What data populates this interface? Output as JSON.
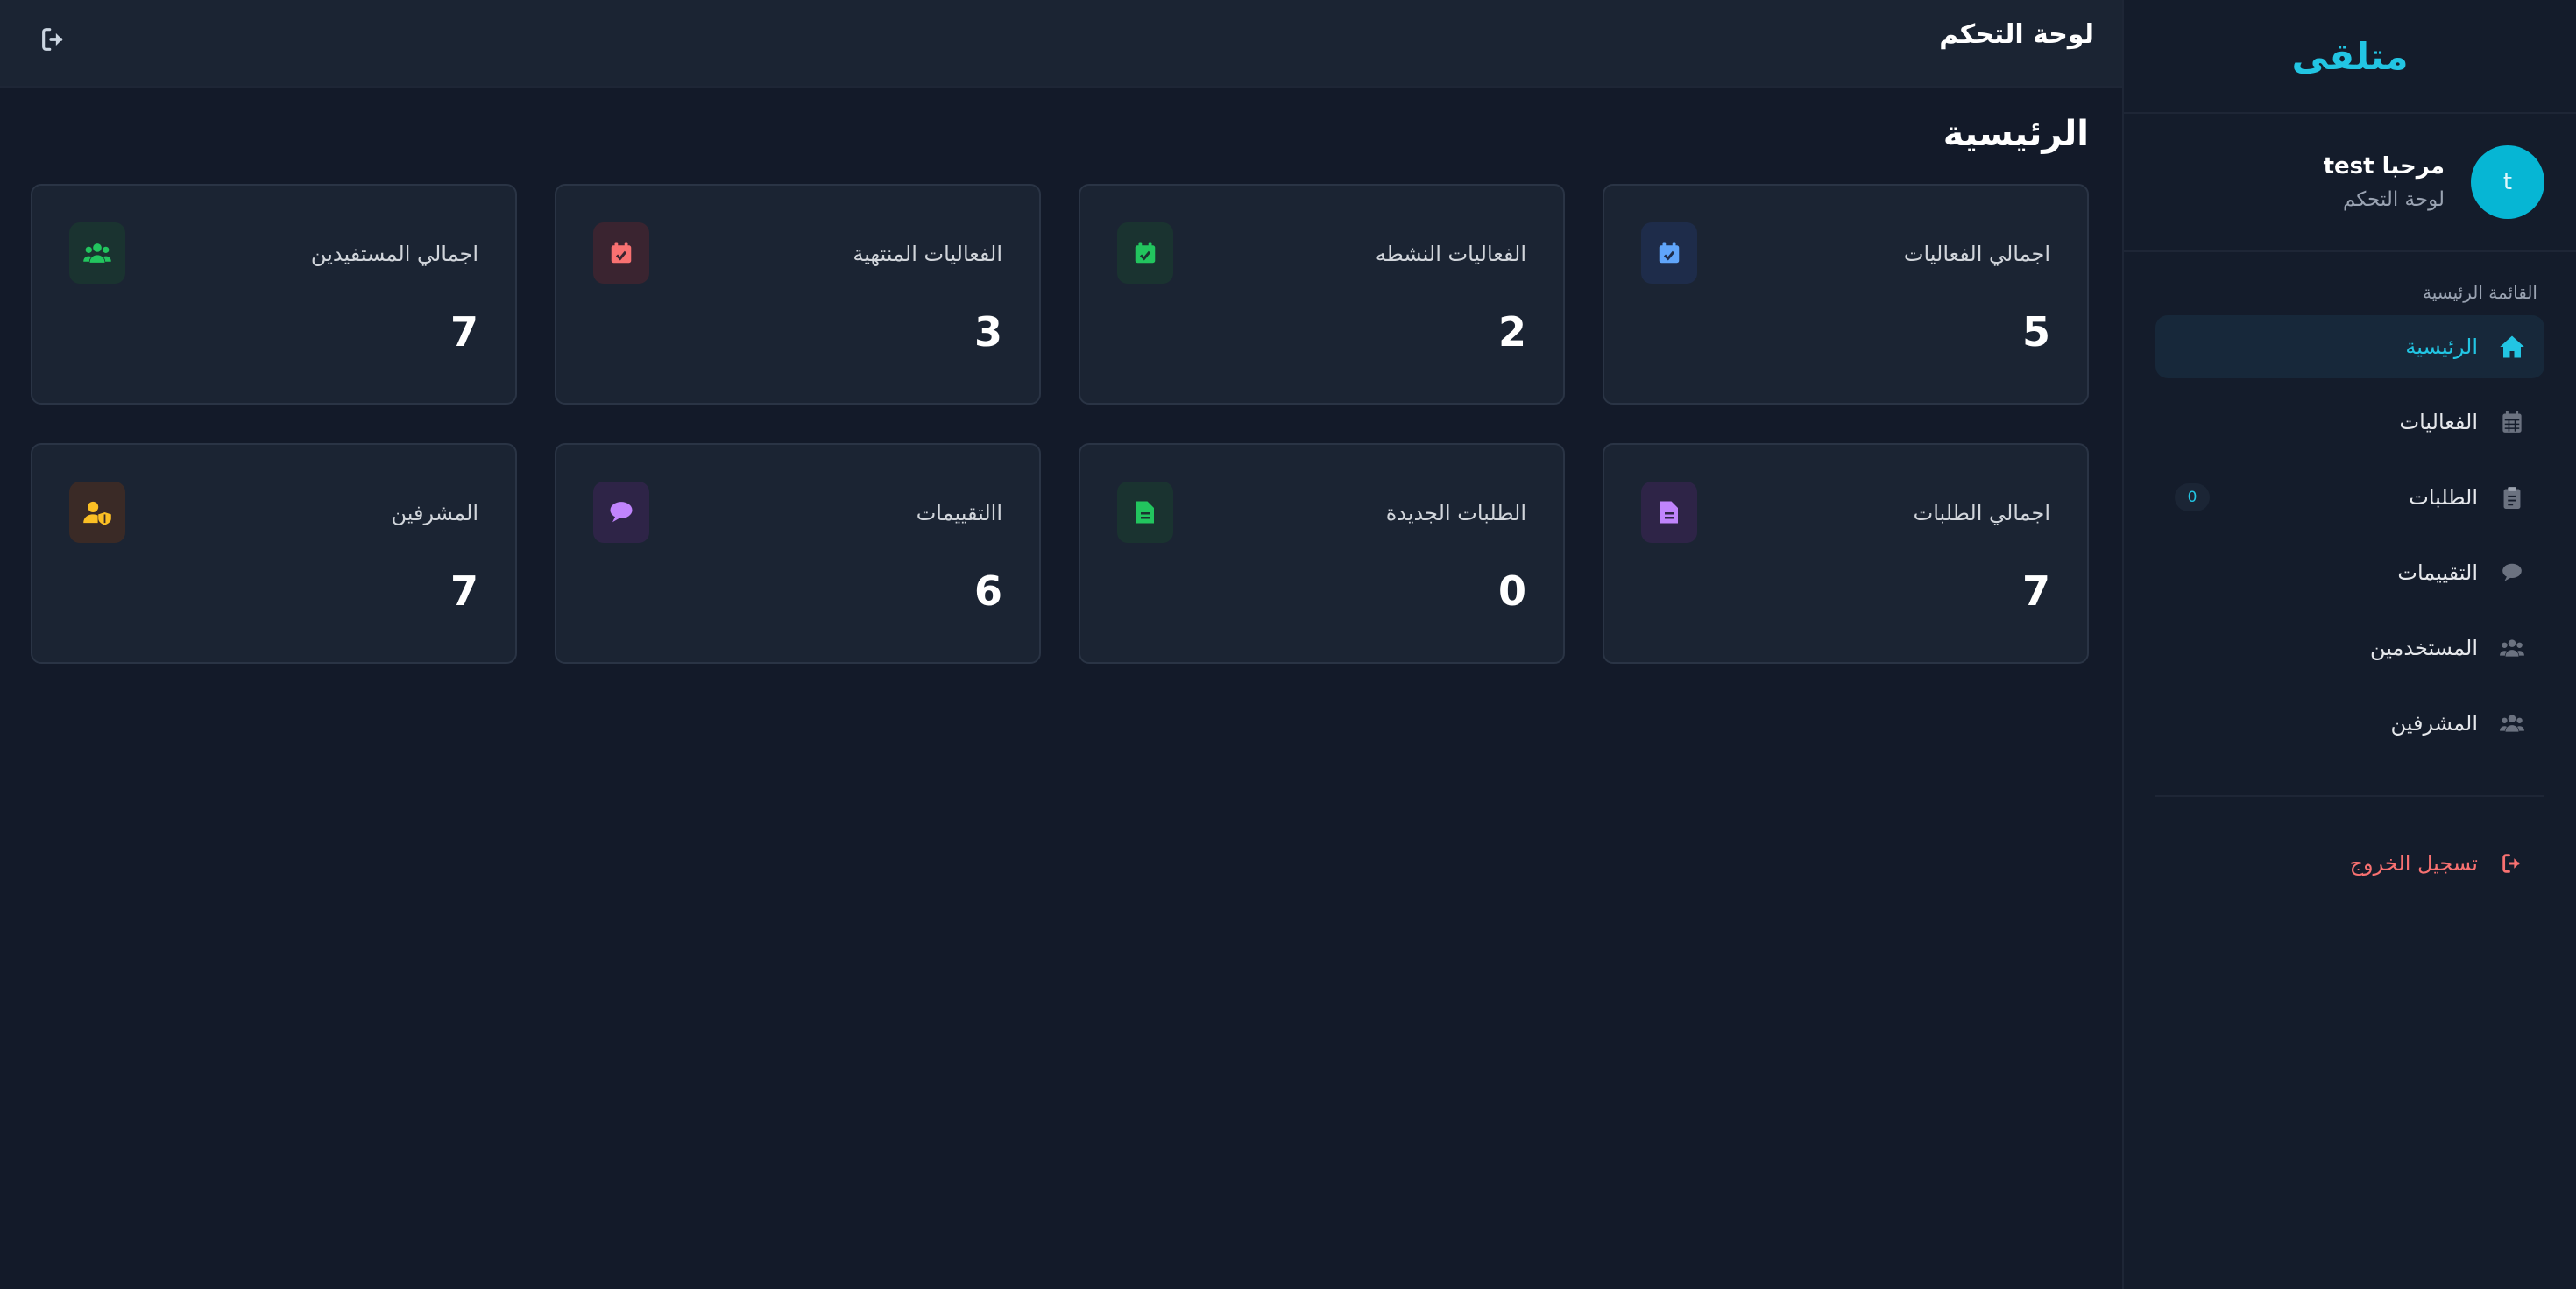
{
  "sidebar": {
    "brand": "متلقى",
    "profile": {
      "avatar_letter": "t",
      "greeting": "مرحبا test",
      "subtitle": "لوحة التحكم"
    },
    "menu_title": "القائمة الرئيسية",
    "items": [
      {
        "label": "الرئيسية",
        "icon": "home-icon",
        "active": true
      },
      {
        "label": "الفعاليات",
        "icon": "calendar-icon"
      },
      {
        "label": "الطلبات",
        "icon": "clipboard-icon",
        "badge": "0"
      },
      {
        "label": "التقييمات",
        "icon": "comment-icon"
      },
      {
        "label": "المستخدمين",
        "icon": "users-icon"
      },
      {
        "label": "المشرفين",
        "icon": "users-icon"
      }
    ],
    "logout_label": "تسجيل الخروج"
  },
  "topbar": {
    "title": "لوحة التحكم",
    "logout_icon": "sign-out-icon"
  },
  "main": {
    "title": "الرئيسية",
    "cards": [
      {
        "label": "اجمالي الفعاليات",
        "value": "5",
        "icon": "calendar-check-icon",
        "color": "#60a5fa"
      },
      {
        "label": "الفعاليات النشطه",
        "value": "2",
        "icon": "calendar-check-icon",
        "color": "#22c55e"
      },
      {
        "label": "الفعاليات المنتهية",
        "value": "3",
        "icon": "calendar-check-icon",
        "color": "#f87171"
      },
      {
        "label": "اجمالي المستفيدين",
        "value": "7",
        "icon": "users-icon",
        "color": "#22c55e"
      },
      {
        "label": "اجمالي الطلبات",
        "value": "7",
        "icon": "file-icon",
        "color": "#c084fc"
      },
      {
        "label": "الطلبات الجديدة",
        "value": "0",
        "icon": "file-icon",
        "color": "#22c55e"
      },
      {
        "label": "االتقييمات",
        "value": "6",
        "icon": "comment-icon",
        "color": "#c084fc"
      },
      {
        "label": "المشرفين",
        "value": "7",
        "icon": "user-shield-icon",
        "color": "#fbbf24"
      }
    ]
  },
  "colors": {
    "accent": "#22c5e3",
    "background": "#131a29",
    "card": "#1b2433",
    "danger": "#f87171"
  }
}
